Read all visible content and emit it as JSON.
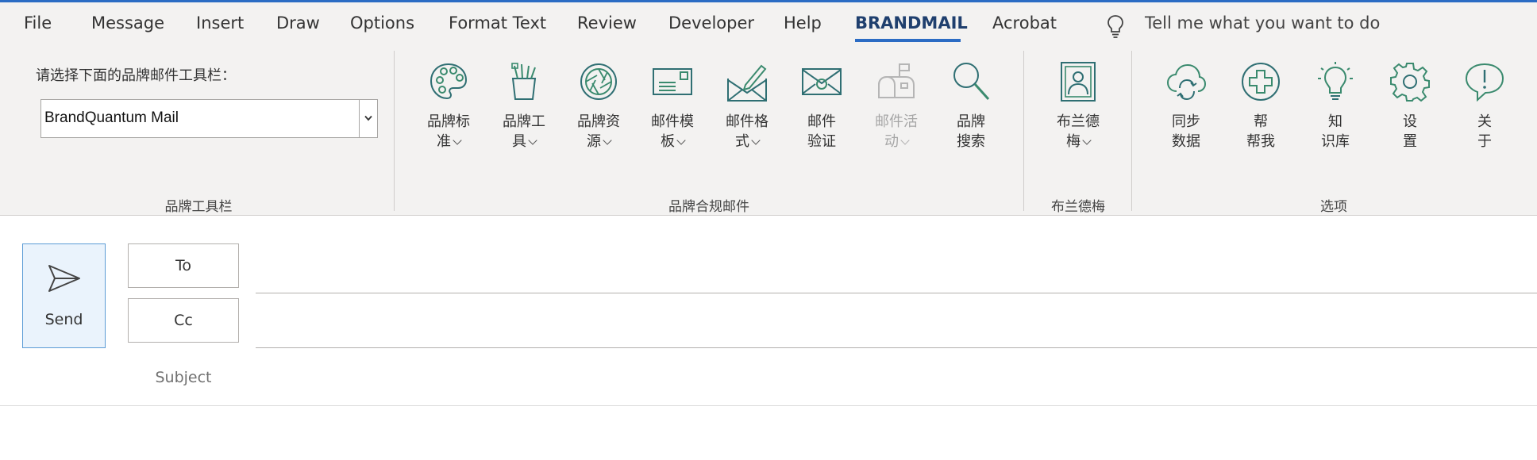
{
  "menu": {
    "tabs": [
      {
        "label": "File"
      },
      {
        "label": "Message"
      },
      {
        "label": "Insert"
      },
      {
        "label": "Draw"
      },
      {
        "label": "Options"
      },
      {
        "label": "Format Text"
      },
      {
        "label": "Review"
      },
      {
        "label": "Developer"
      },
      {
        "label": "Help"
      },
      {
        "label": "BRANDMAIL"
      },
      {
        "label": "Acrobat"
      }
    ],
    "active_tab": "BRANDMAIL",
    "tell_me": "Tell me what you want to do"
  },
  "ribbon": {
    "toolbar_group": {
      "prompt": "请选择下面的品牌邮件工具栏：",
      "selected": "BrandQuantum Mail",
      "label": "品牌工具栏"
    },
    "compliance_group": {
      "label": "品牌合规邮件",
      "buttons": [
        {
          "line1": "品牌标",
          "line2": "准",
          "icon": "palette-icon"
        },
        {
          "line1": "品牌工",
          "line2": "具",
          "icon": "pencil-cup-icon"
        },
        {
          "line1": "品牌资",
          "line2": "源",
          "icon": "aperture-icon"
        },
        {
          "line1": "邮件模",
          "line2": "板",
          "icon": "envelope-template-icon"
        },
        {
          "line1": "邮件格",
          "line2": "式",
          "icon": "envelope-pen-icon"
        },
        {
          "line1": "邮件",
          "line2": "验证",
          "icon": "envelope-verify-icon"
        },
        {
          "line1": "邮件活",
          "line2": "动",
          "icon": "mailbox-icon"
        },
        {
          "line1": "品牌",
          "line2": "搜索",
          "icon": "search-icon"
        }
      ]
    },
    "brand_group": {
      "label": "布兰德梅",
      "button": {
        "line1": "布兰德",
        "line2": "梅",
        "icon": "portrait-icon"
      }
    },
    "options_group": {
      "label": "选项",
      "buttons": [
        {
          "line1": "同步",
          "line2": "数据",
          "icon": "cloud-sync-icon"
        },
        {
          "line1": "帮",
          "line2": "帮我",
          "icon": "plus-circle-icon"
        },
        {
          "line1": "知",
          "line2": "识库",
          "icon": "lightbulb-icon"
        },
        {
          "line1": "设",
          "line2": "置",
          "icon": "gear-icon"
        },
        {
          "line1": "关",
          "line2": "于",
          "icon": "info-bubble-icon"
        }
      ]
    }
  },
  "compose": {
    "send_label": "Send",
    "to_label": "To",
    "cc_label": "Cc",
    "subject_label": "Subject"
  },
  "colors": {
    "accent_blue": "#2b6cc4",
    "icon_green": "#3a8a6e",
    "icon_teal": "#2f6f73",
    "ribbon_bg": "#f3f2f1"
  }
}
